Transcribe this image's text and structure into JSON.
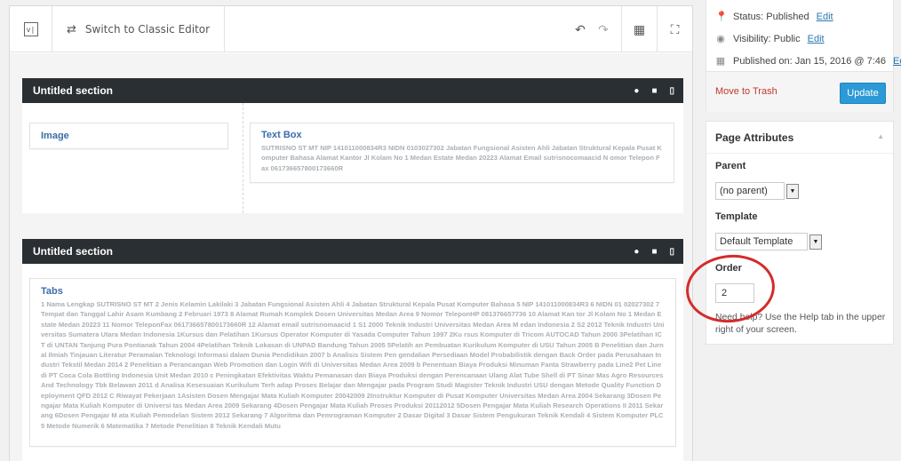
{
  "toolbar": {
    "logo_glyph": "v|",
    "classic_label": "Switch to Classic Editor"
  },
  "sections": [
    {
      "title": "Untitled section",
      "elements": [
        {
          "title": "Image",
          "text": ""
        },
        {
          "title": "Text Box",
          "text": "SUTRISNO ST MT NIP 141011000834R3 NIDN 0103027302 Jabatan Fungsional Asisten Ahli Jabatan Struktural Kepala Pusat Komputer Bahasa Alamat Kantor Jl Kolam No 1 Medan Estate Medan 20223 Alamat Email sutrisnocomaacid N omor Telepon Fax 061736657800173660R"
        }
      ]
    },
    {
      "title": "Untitled section",
      "elements": [
        {
          "title": "Tabs",
          "text": "1 Nama Lengkap SUTRISNO ST MT 2 Jenis Kelamin Lakilaki 3 Jabatan Fungsional Asisten Ahli 4 Jabatan Struktural Kepala Pusat Komputer Bahasa 5 NIP 141011000834R3 6 NIDN 01 02027302 7 Tempat dan Tanggal Lahir Asam Kumbang 2 Februari 1973 8 Alamat Rumah Komplek Dosen Universitas Medan Area 9 Nomor TeleponHP 081376657736 10 Alamat Kan tor Jl Kolam No 1 Medan Estate Medan 20223 11 Nomor TeleponFax 061736657800173660R 12 Alamat email sutrisnomaacid 1 S1 2000 Teknik Industri Universitas Medan Area M edan Indonesia 2 S2 2012 Teknik Industri Universitas Sumatera Utara Medan Indonesia 1Kursus dan Pelatihan 1Kursus Operator Komputer di Yasada Computer Tahun 1997 2Ku rsus Komputer di Tricom AUTOCAD Tahun 2000 3Pelatihan ICT di UNTAN Tanjung Pura Pontianak Tahun 2004 4Pelatihan Teknik Lokasan di UNPAD Bandung Tahun 2005 5Pelatih an Pembuatan Kurikulum Komputer di USU Tahun 2005 B Penelitian dan Jurnal Ilmiah Tinjauan Literatur Peramalan Teknologi Informasi dalam Dunia Pendidikan 2007 b Analisis Sistem Pen gendalian Persediaan Model Probabilistik dengan Back Order pada Perusahaan Industri Tekstil Medan 2014 2 Penelitian a Perancangan Web Promotion dan Login Wifi di Universitas Medan Area 2009 b Penentuan Biaya Produksi Minuman Fanta Strawberry pada Line2 Pet Line di PT Coca Cola Bottling Indonesia Unit Medan 2010 c Peningkatan Efektivitas Waktu Pemanasan dan Biaya Produksi dengan Perencanaan Ulang Alat Tube Shell di PT Sinar Mas Agro Resources And Technology Tbk Belawan 2011 d Analisa Kesesuaian Kurikulum Terh adap Proses Belajar dan Mengajar pada Program Studi Magister Teknik Industri USU dengan Metode Quality Function Deployment QFD 2012 C Riwayat Pekerjaan 1Asisten Dosen Mengajar Mata Kuliah Komputer 20042009 2Instruktur Komputer di Pusat Komputer Universitas Medan Area 2004 Sekarang 3Dosen Pengajar Mata Kuliah Komputer di Universi tas Medan Area 2009 Sekarang 4Dosen Pengajar Mata Kuliah Proses Produksi 20112012 5Dosen Pengajar Mata Kuliah Research Operations II 2011 Sekarang 6Dosen Pengajar M ata Kuliah Pemodelan Sistem 2012 Sekarang 7 Algoritma dan Pemrograman Komputer 2 Dasar Digital 3 Dasar Sistem Pengukuran Teknik Kendali 4 Sistem Komputer PLC 5 Metode Numerik 6 Matematika 7 Metode Penelitian 8 Teknik Kendali Mutu"
        }
      ]
    }
  ],
  "publish": {
    "status_label": "Status: Published",
    "visibility_label": "Visibility: Public",
    "published_label": "Published on: Jan 15, 2016 @ 7:46",
    "edit_link": "Edit",
    "trash_label": "Move to Trash",
    "update_label": "Update"
  },
  "page_attributes": {
    "title": "Page Attributes",
    "parent_label": "Parent",
    "parent_value": "(no parent)",
    "template_label": "Template",
    "template_value": "Default Template",
    "order_label": "Order",
    "order_value": "2",
    "help_text": "Need help? Use the Help tab in the upper right of your screen."
  },
  "annotation": {
    "color": "#d42b2b"
  }
}
